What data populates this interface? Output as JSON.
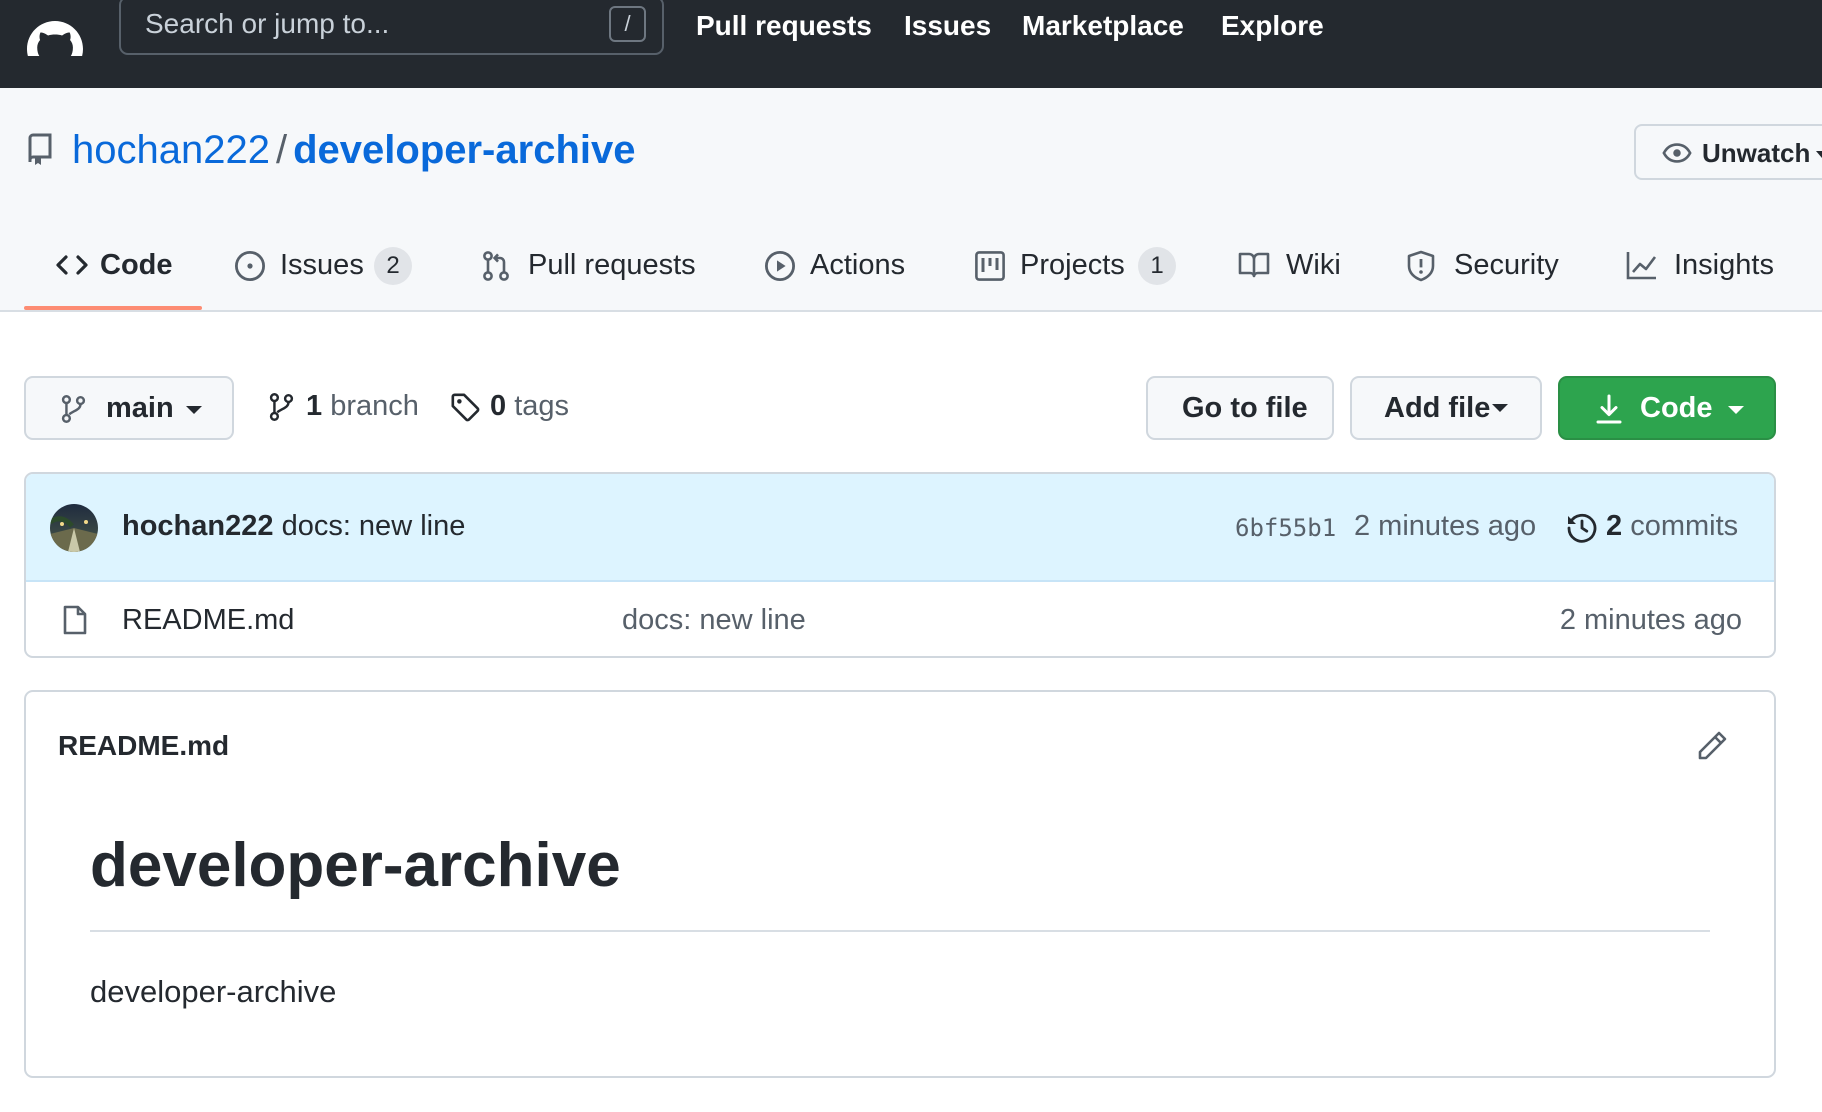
{
  "header": {
    "search_placeholder": "Search or jump to...",
    "search_shortcut": "/",
    "nav": [
      "Pull requests",
      "Issues",
      "Marketplace",
      "Explore"
    ]
  },
  "repo": {
    "owner": "hochan222",
    "separator": "/",
    "name": "developer-archive",
    "watch_label": "Unwatch"
  },
  "tabs": [
    {
      "label": "Code",
      "icon": "code-icon",
      "selected": true
    },
    {
      "label": "Issues",
      "icon": "issue-opened-icon",
      "count": "2"
    },
    {
      "label": "Pull requests",
      "icon": "git-pull-request-icon"
    },
    {
      "label": "Actions",
      "icon": "play-icon"
    },
    {
      "label": "Projects",
      "icon": "project-icon",
      "count": "1"
    },
    {
      "label": "Wiki",
      "icon": "book-icon"
    },
    {
      "label": "Security",
      "icon": "shield-icon"
    },
    {
      "label": "Insights",
      "icon": "graph-icon"
    }
  ],
  "filenav": {
    "branch": "main",
    "branch_count": "1",
    "branch_word": "branch",
    "tag_count": "0",
    "tag_word": "tags",
    "goto_label": "Go to file",
    "add_label": "Add file",
    "code_label": "Code"
  },
  "latest_commit": {
    "author": "hochan222",
    "message": "docs: new line",
    "sha": "6bf55b1",
    "time": "2 minutes ago",
    "commit_count": "2",
    "commit_word": "commits"
  },
  "files": [
    {
      "name": "README.md",
      "message": "docs: new line",
      "time": "2 minutes ago",
      "icon": "file-icon"
    }
  ],
  "readme": {
    "filename": "README.md",
    "heading": "developer-archive",
    "body": "developer-archive"
  },
  "colors": {
    "header_bg": "#24292f",
    "link": "#0969da",
    "tab_underline": "#fd8c73",
    "code_button": "#2da44e",
    "commit_bar": "#ddf4ff"
  }
}
